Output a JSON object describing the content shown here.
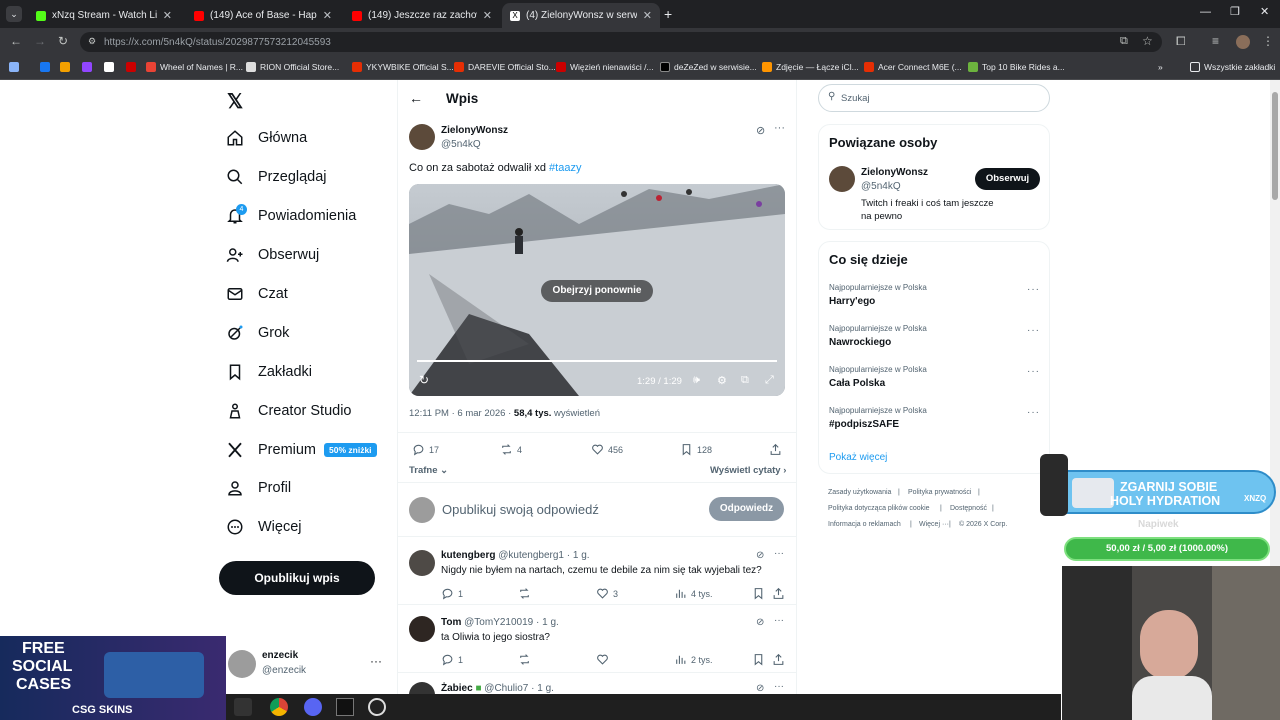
{
  "tabs": [
    {
      "label": "xNzq Stream - Watch Live on K",
      "color": "#53fc18"
    },
    {
      "label": "(149) Ace of Base - Happy Natio",
      "color": "#ff0000"
    },
    {
      "label": "(149) Jeszcze raz zachowasz się",
      "color": "#ff0000"
    },
    {
      "label": "(4) ZielonyWonsz w serwisie X:",
      "color": "#000000"
    }
  ],
  "address": "https://x.com/5n4kQ/status/2029877573212045593",
  "bookmarks": [
    {
      "label": "",
      "color": "#1877f2"
    },
    {
      "label": "",
      "color": "#f4a000"
    },
    {
      "label": "",
      "color": "#9146ff"
    },
    {
      "label": "",
      "color": "#000000"
    },
    {
      "label": "",
      "color": "#c00"
    },
    {
      "label": "Wheel of Names | R...",
      "color": "#ea4335"
    },
    {
      "label": "RION Official Store...",
      "color": "#ddd"
    },
    {
      "label": "YKYWBIKE Official S...",
      "color": "#e62e04"
    },
    {
      "label": "DAREVIE Official Sto...",
      "color": "#e62e04"
    },
    {
      "label": "Więzień nienawiści /...",
      "color": "#c00"
    },
    {
      "label": "deZeZed w serwisie...",
      "color": "#000"
    },
    {
      "label": "Zdjęcie — Łącze iCl...",
      "color": "#ff9500"
    },
    {
      "label": "Acer Connect M6E (...",
      "color": "#e62e04"
    },
    {
      "label": "Top 10 Bike Rides a...",
      "color": "#6cb33e"
    }
  ],
  "bookmarks_all": "Wszystkie zakładki",
  "nav": {
    "home": "Główna",
    "explore": "Przeglądaj",
    "notifications": "Powiadomienia",
    "notif_count": "4",
    "follow": "Obserwuj",
    "chat": "Czat",
    "grok": "Grok",
    "bookmarks": "Zakładki",
    "creator": "Creator Studio",
    "premium": "Premium",
    "premium_badge": "50% zniżki",
    "profile": "Profil",
    "more": "Więcej",
    "post_button": "Opublikuj wpis",
    "account_name": "enzecik",
    "account_handle": "@enzecik"
  },
  "header": {
    "title": "Wpis"
  },
  "post": {
    "name": "ZielonyWonsz",
    "handle": "@5n4kQ",
    "text": "Co on za sabotaż odwalił xd ",
    "hashtag": "#taazy",
    "replay_label": "Obejrzyj ponownie",
    "time": "1:29 / 1:29",
    "progress": 1.0,
    "timestamp": "12:11 PM · 6 mar 2026 · ",
    "views": "58,4 tys.",
    "views_label": " wyświetleń",
    "replies": "17",
    "reposts": "4",
    "likes": "456",
    "bookmarks": "128"
  },
  "sort": {
    "left": "Trafne",
    "right": "Wyświetl cytaty"
  },
  "reply_box": {
    "placeholder": "Opublikuj swoją odpowiedź",
    "button": "Odpowiedz"
  },
  "replies": [
    {
      "name": "kutengberg",
      "handle": "@kutengberg1 · 1 g.",
      "text": "Nigdy nie byłem na nartach, czemu te debile za nim się tak wyjebali tez?",
      "replies": "1",
      "reposts": "",
      "likes": "3",
      "views": "4 tys."
    },
    {
      "name": "Tom",
      "handle": "@TomY210019 · 1 g.",
      "text": "ta Oliwia to jego siostra?",
      "replies": "1",
      "reposts": "",
      "likes": "",
      "views": "2 tys."
    },
    {
      "name": "Żabiec",
      "handle": "@Chulio7 · 1 g.",
      "text": "",
      "replies": "",
      "reposts": "",
      "likes": "",
      "views": ""
    }
  ],
  "search": {
    "placeholder": "Szukaj"
  },
  "related": {
    "title": "Powiązane osoby",
    "name": "ZielonyWonsz",
    "handle": "@5n4kQ",
    "bio": "Twitch i freaki i coś tam jeszcze na pewno",
    "follow": "Obserwuj"
  },
  "trends": {
    "title": "Co się dzieje",
    "items": [
      {
        "cat": "Najpopularniejsze w Polska",
        "name": "Harry'ego"
      },
      {
        "cat": "Najpopularniejsze w Polska",
        "name": "Nawrockiego"
      },
      {
        "cat": "Najpopularniejsze w Polska",
        "name": "Cała Polska"
      },
      {
        "cat": "Najpopularniejsze w Polska",
        "name": "#podpiszSAFE"
      }
    ],
    "more": "Pokaż więcej"
  },
  "footer": [
    "Zasady użytkowania",
    "Polityka prywatności",
    "Polityka dotycząca plików cookie",
    "Dostępność",
    "Informacja o reklamach",
    "Więcej ···",
    "© 2026 X Corp."
  ],
  "overlays": {
    "promo_title": "ZGARNIJ SOBIE",
    "promo_title2": "HOLY HYDRATION",
    "promo_brand": "XNZQ",
    "promo_sub": "Napiwek",
    "tip_bar": "50,00 zł / 5,00 zł (1000.00%)",
    "ad_line1": "FREE",
    "ad_line2": "SOCIAL",
    "ad_line3": "CASES",
    "ad_brand": "CSG SKINS"
  }
}
